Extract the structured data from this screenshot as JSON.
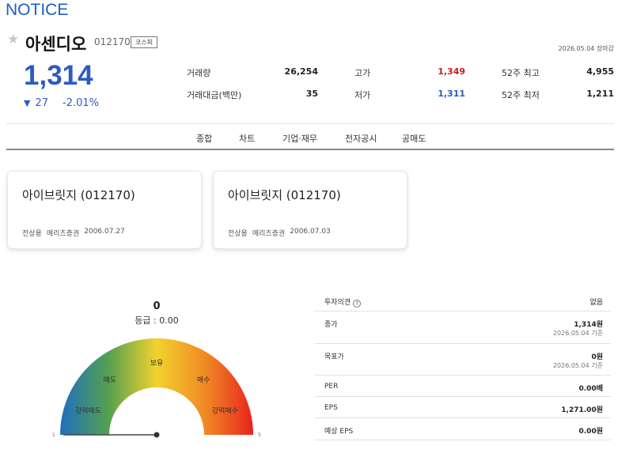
{
  "notice": "NOTICE",
  "stock": {
    "name": "아센디오",
    "code": "012170",
    "market": "코스피",
    "as_of": "2026.05.04 장마감",
    "price": "1,314",
    "change_arrow": "▼",
    "change": "27",
    "change_pct": "-2.01%"
  },
  "quote": {
    "volume_label": "거래량",
    "volume": "26,254",
    "amount_label": "거래대금(백만)",
    "amount": "35",
    "high_label": "고가",
    "high": "1,349",
    "low_label": "저가",
    "low": "1,311",
    "w52_high_label": "52주 최고",
    "w52_high": "4,955",
    "w52_low_label": "52주 최저",
    "w52_low": "1,211"
  },
  "tabs": [
    "종합",
    "차트",
    "기업·재무",
    "전자공시",
    "공매도"
  ],
  "cards": [
    {
      "title": "아이브릿지 (012170)",
      "analyst": "전상용",
      "firm": "메리츠증권",
      "date": "2006.07.27"
    },
    {
      "title": "아이브릿지 (012170)",
      "analyst": "전상용",
      "firm": "메리츠증권",
      "date": "2006.07.03"
    }
  ],
  "gauge": {
    "score": "0",
    "grade_text": "등급 : 0.00",
    "value": 0,
    "labels": [
      "강력매도",
      "매도",
      "보유",
      "매수",
      "강력매수"
    ],
    "min_label": "1",
    "max_label": "5",
    "colors": [
      "#1e6fc0",
      "#55a050",
      "#f3d22e",
      "#f08a26",
      "#e8231c"
    ]
  },
  "opinion": {
    "header_label": "투자의견",
    "header_value": "없음",
    "close_label": "종가",
    "close_value": "1,314원",
    "close_date": "2026.05.04 기준",
    "target_label": "목표가",
    "target_value": "0원",
    "target_date": "2026.05.04 기준",
    "per_label": "PER",
    "per_value": "0.00배",
    "eps_label": "EPS",
    "eps_value": "1,271.00원",
    "est_eps_label": "예상 EPS",
    "est_eps_value": "0.00원"
  }
}
